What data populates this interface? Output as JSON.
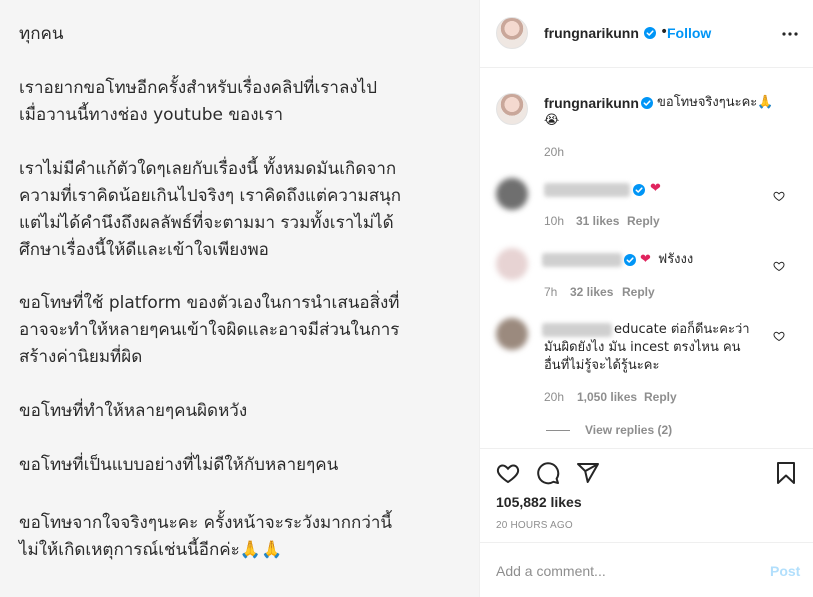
{
  "post_image": {
    "paragraphs": [
      [
        "ทุกคน"
      ],
      [
        "เราอยากขอโทษอีกครั้งสำหรับเรื่องคลิปที่เราลงไป",
        "เมื่อวานนี้ทางช่อง youtube ของเรา"
      ],
      [
        "เราไม่มีคำแก้ตัวใดๆเลยกับเรื่องนี้ ทั้งหมดมันเกิดจาก",
        "ความที่เราคิดน้อยเกินไปจริงๆ เราคิดถึงแต่ความสนุก",
        "แต่ไม่ได้คำนึงถึงผลลัพธ์ที่จะตามมา รวมทั้งเราไม่ได้",
        "ศึกษาเรื่องนี้ให้ดีและเข้าใจเพียงพอ"
      ],
      [
        "ขอโทษที่ใช้ platform ของตัวเองในการนำเสนอสิ่งที่",
        "อาจจะทำให้หลายๆคนเข้าใจผิดและอาจมีส่วนในการ",
        "สร้างค่านิยมที่ผิด"
      ],
      [
        "ขอโทษที่ทำให้หลายๆคนผิดหวัง"
      ],
      [
        "ขอโทษที่เป็นแบบอย่างที่ไม่ดีให้กับหลายๆคน"
      ],
      [
        "ขอโทษจากใจจริงๆนะคะ ครั้งหน้าจะระวังมากกว่านี้",
        "ไม่ให้เกิดเหตุการณ์เช่นนี้อีกค่ะ🙏🙏"
      ]
    ]
  },
  "header": {
    "username": "frungnarikunn",
    "separator": "•",
    "follow_label": "Follow"
  },
  "caption": {
    "username": "frungnarikunn",
    "text": "ขอโทษจริงๆนะคะ🙏",
    "emoji_line": "😭",
    "time": "20h"
  },
  "comments": [
    {
      "text": "",
      "heart": "❤",
      "time": "10h",
      "likes": "31 likes",
      "reply": "Reply"
    },
    {
      "text": "ฟรังงง",
      "heart": "❤",
      "time": "7h",
      "likes": "32 likes",
      "reply": "Reply"
    },
    {
      "lines": [
        "educate ต่อก็ดีนะคะว่า",
        "มันผิดยังไง มัน incest ตรงไหน คน",
        "อื่นที่ไม่รู้จะได้รู้นะคะ"
      ],
      "time": "20h",
      "likes": "1,050 likes",
      "reply": "Reply",
      "view_replies": "View replies (2)"
    }
  ],
  "actions": {
    "icons": [
      "heart-icon",
      "comment-icon",
      "share-icon",
      "bookmark-icon"
    ],
    "likes": "105,882 likes",
    "timestamp": "20 HOURS AGO"
  },
  "add_comment": {
    "placeholder": "Add a comment...",
    "post_label": "Post"
  },
  "colors": {
    "accent": "#0095f6",
    "heart_red": "#ed4956",
    "muted": "#8e8e8e"
  }
}
